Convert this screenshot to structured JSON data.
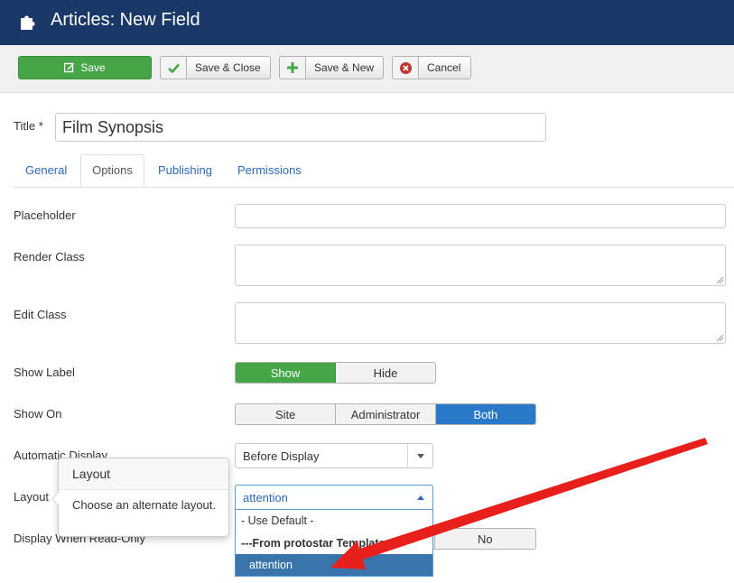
{
  "header": {
    "title": "Articles: New Field",
    "icon": "puzzle-icon"
  },
  "toolbar": {
    "save": "Save",
    "save_close": "Save & Close",
    "save_new": "Save & New",
    "cancel": "Cancel"
  },
  "form": {
    "title_label": "Title *",
    "title_value": "Film Synopsis"
  },
  "tabs": [
    "General",
    "Options",
    "Publishing",
    "Permissions"
  ],
  "active_tab": "Options",
  "fields": {
    "placeholder_label": "Placeholder",
    "render_class_label": "Render Class",
    "edit_class_label": "Edit Class",
    "show_label": {
      "label": "Show Label",
      "options": [
        "Show",
        "Hide"
      ],
      "selected": "Show"
    },
    "show_on": {
      "label": "Show On",
      "options": [
        "Site",
        "Administrator",
        "Both"
      ],
      "selected": "Both"
    },
    "automatic_display": {
      "label": "Automatic Display",
      "value": "Before Display"
    },
    "layout": {
      "label": "Layout",
      "value": "attention",
      "options": [
        "- Use Default -",
        "---From protostar Template",
        "attention"
      ],
      "highlighted": "attention"
    },
    "display_readonly": {
      "label": "Display When Read-Only",
      "visible_option": "No"
    }
  },
  "popover": {
    "title": "Layout",
    "body": "Choose an alternate layout."
  },
  "colors": {
    "header_bg": "#1a3867",
    "save_green": "#46a546",
    "active_blue": "#2a79c8",
    "link_blue": "#2a69b8",
    "annotation_red": "#e8201c"
  }
}
